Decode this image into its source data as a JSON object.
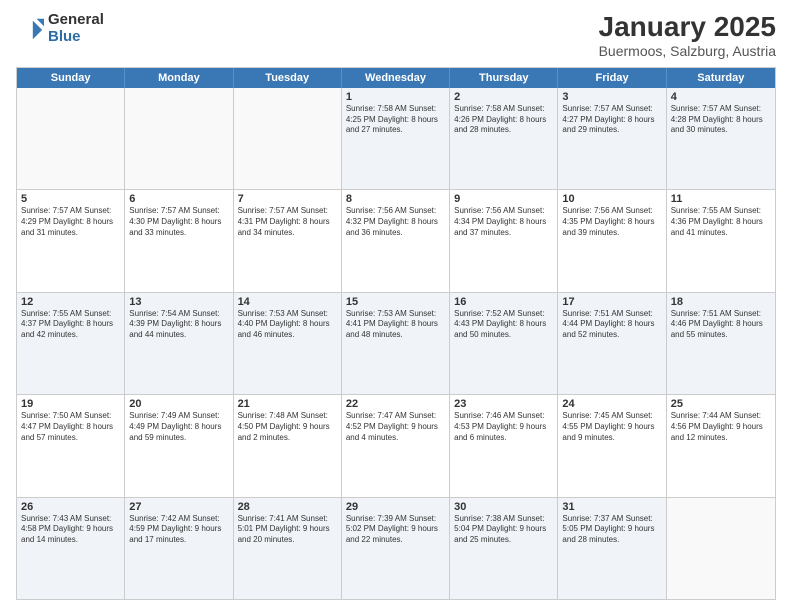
{
  "logo": {
    "general": "General",
    "blue": "Blue"
  },
  "title": "January 2025",
  "location": "Buermoos, Salzburg, Austria",
  "weekdays": [
    "Sunday",
    "Monday",
    "Tuesday",
    "Wednesday",
    "Thursday",
    "Friday",
    "Saturday"
  ],
  "weeks": [
    [
      {
        "day": "",
        "info": ""
      },
      {
        "day": "",
        "info": ""
      },
      {
        "day": "",
        "info": ""
      },
      {
        "day": "1",
        "info": "Sunrise: 7:58 AM\nSunset: 4:25 PM\nDaylight: 8 hours and 27 minutes."
      },
      {
        "day": "2",
        "info": "Sunrise: 7:58 AM\nSunset: 4:26 PM\nDaylight: 8 hours and 28 minutes."
      },
      {
        "day": "3",
        "info": "Sunrise: 7:57 AM\nSunset: 4:27 PM\nDaylight: 8 hours and 29 minutes."
      },
      {
        "day": "4",
        "info": "Sunrise: 7:57 AM\nSunset: 4:28 PM\nDaylight: 8 hours and 30 minutes."
      }
    ],
    [
      {
        "day": "5",
        "info": "Sunrise: 7:57 AM\nSunset: 4:29 PM\nDaylight: 8 hours and 31 minutes."
      },
      {
        "day": "6",
        "info": "Sunrise: 7:57 AM\nSunset: 4:30 PM\nDaylight: 8 hours and 33 minutes."
      },
      {
        "day": "7",
        "info": "Sunrise: 7:57 AM\nSunset: 4:31 PM\nDaylight: 8 hours and 34 minutes."
      },
      {
        "day": "8",
        "info": "Sunrise: 7:56 AM\nSunset: 4:32 PM\nDaylight: 8 hours and 36 minutes."
      },
      {
        "day": "9",
        "info": "Sunrise: 7:56 AM\nSunset: 4:34 PM\nDaylight: 8 hours and 37 minutes."
      },
      {
        "day": "10",
        "info": "Sunrise: 7:56 AM\nSunset: 4:35 PM\nDaylight: 8 hours and 39 minutes."
      },
      {
        "day": "11",
        "info": "Sunrise: 7:55 AM\nSunset: 4:36 PM\nDaylight: 8 hours and 41 minutes."
      }
    ],
    [
      {
        "day": "12",
        "info": "Sunrise: 7:55 AM\nSunset: 4:37 PM\nDaylight: 8 hours and 42 minutes."
      },
      {
        "day": "13",
        "info": "Sunrise: 7:54 AM\nSunset: 4:39 PM\nDaylight: 8 hours and 44 minutes."
      },
      {
        "day": "14",
        "info": "Sunrise: 7:53 AM\nSunset: 4:40 PM\nDaylight: 8 hours and 46 minutes."
      },
      {
        "day": "15",
        "info": "Sunrise: 7:53 AM\nSunset: 4:41 PM\nDaylight: 8 hours and 48 minutes."
      },
      {
        "day": "16",
        "info": "Sunrise: 7:52 AM\nSunset: 4:43 PM\nDaylight: 8 hours and 50 minutes."
      },
      {
        "day": "17",
        "info": "Sunrise: 7:51 AM\nSunset: 4:44 PM\nDaylight: 8 hours and 52 minutes."
      },
      {
        "day": "18",
        "info": "Sunrise: 7:51 AM\nSunset: 4:46 PM\nDaylight: 8 hours and 55 minutes."
      }
    ],
    [
      {
        "day": "19",
        "info": "Sunrise: 7:50 AM\nSunset: 4:47 PM\nDaylight: 8 hours and 57 minutes."
      },
      {
        "day": "20",
        "info": "Sunrise: 7:49 AM\nSunset: 4:49 PM\nDaylight: 8 hours and 59 minutes."
      },
      {
        "day": "21",
        "info": "Sunrise: 7:48 AM\nSunset: 4:50 PM\nDaylight: 9 hours and 2 minutes."
      },
      {
        "day": "22",
        "info": "Sunrise: 7:47 AM\nSunset: 4:52 PM\nDaylight: 9 hours and 4 minutes."
      },
      {
        "day": "23",
        "info": "Sunrise: 7:46 AM\nSunset: 4:53 PM\nDaylight: 9 hours and 6 minutes."
      },
      {
        "day": "24",
        "info": "Sunrise: 7:45 AM\nSunset: 4:55 PM\nDaylight: 9 hours and 9 minutes."
      },
      {
        "day": "25",
        "info": "Sunrise: 7:44 AM\nSunset: 4:56 PM\nDaylight: 9 hours and 12 minutes."
      }
    ],
    [
      {
        "day": "26",
        "info": "Sunrise: 7:43 AM\nSunset: 4:58 PM\nDaylight: 9 hours and 14 minutes."
      },
      {
        "day": "27",
        "info": "Sunrise: 7:42 AM\nSunset: 4:59 PM\nDaylight: 9 hours and 17 minutes."
      },
      {
        "day": "28",
        "info": "Sunrise: 7:41 AM\nSunset: 5:01 PM\nDaylight: 9 hours and 20 minutes."
      },
      {
        "day": "29",
        "info": "Sunrise: 7:39 AM\nSunset: 5:02 PM\nDaylight: 9 hours and 22 minutes."
      },
      {
        "day": "30",
        "info": "Sunrise: 7:38 AM\nSunset: 5:04 PM\nDaylight: 9 hours and 25 minutes."
      },
      {
        "day": "31",
        "info": "Sunrise: 7:37 AM\nSunset: 5:05 PM\nDaylight: 9 hours and 28 minutes."
      },
      {
        "day": "",
        "info": ""
      }
    ]
  ],
  "shadedRows": [
    0,
    2,
    4
  ]
}
